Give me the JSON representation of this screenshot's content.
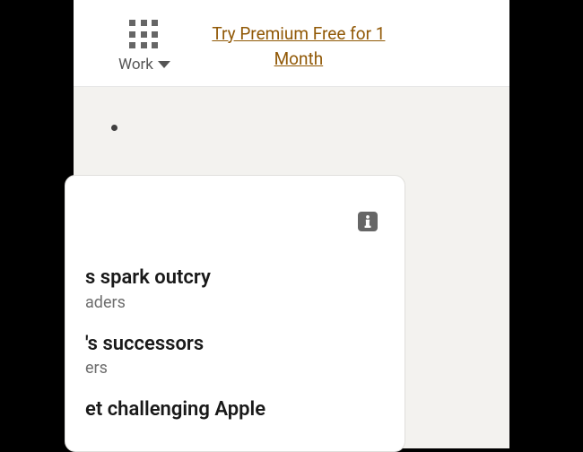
{
  "nav": {
    "work_label": "Work",
    "premium_link": "Try Premium Free for 1 Month"
  },
  "news": {
    "items": [
      {
        "title_fragment": "s spark outcry",
        "meta_fragment": "aders"
      },
      {
        "title_fragment": "'s successors",
        "meta_fragment": "ers"
      },
      {
        "title_fragment": "et challenging Apple",
        "meta_fragment": ""
      }
    ]
  }
}
